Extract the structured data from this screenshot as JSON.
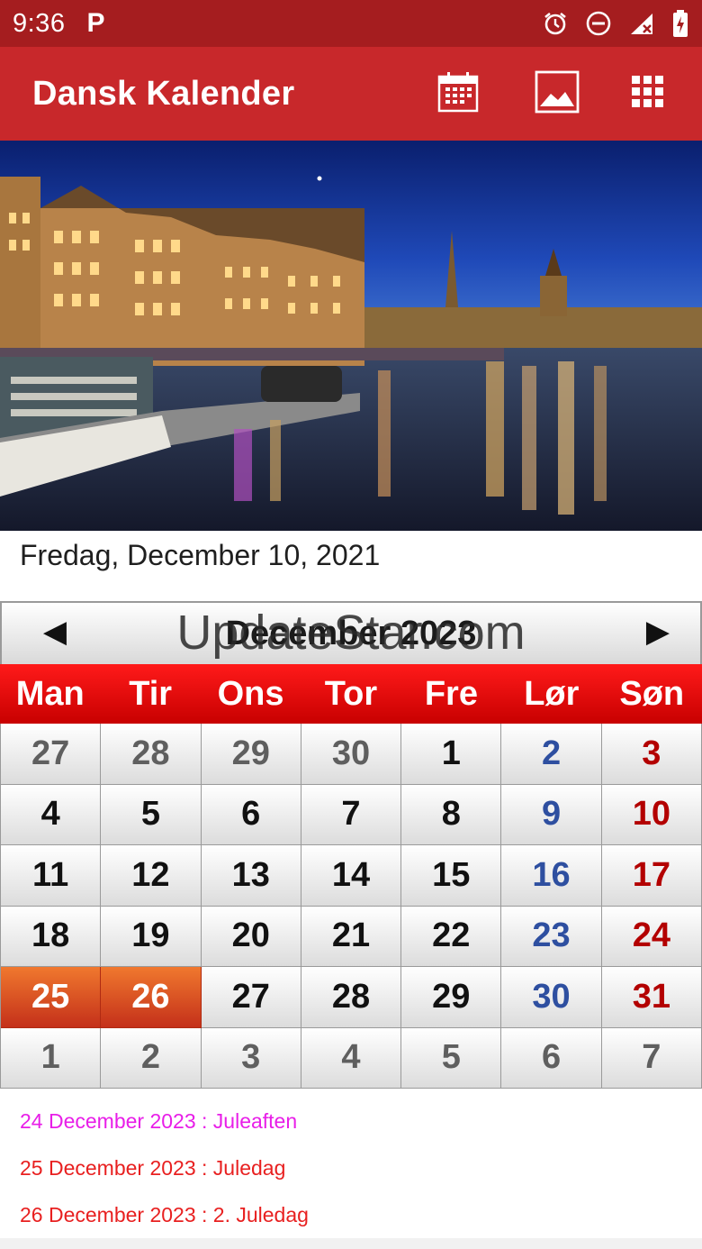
{
  "status_bar": {
    "time": "9:36",
    "notification_icon": "P"
  },
  "app_bar": {
    "title": "Dansk Kalender",
    "actions": [
      "calendar-icon",
      "image-icon",
      "grid-icon"
    ]
  },
  "selected_date": "Fredag, December 10, 2021",
  "calendar": {
    "prev_arrow": "◀",
    "next_arrow": "▶",
    "month_title": "December 2023",
    "watermark": "UpdateStar.com",
    "weekdays": [
      "Man",
      "Tir",
      "Ons",
      "Tor",
      "Fre",
      "Lør",
      "Søn"
    ],
    "weeks": [
      [
        "27",
        "28",
        "29",
        "30",
        "1",
        "2",
        "3"
      ],
      [
        "4",
        "5",
        "6",
        "7",
        "8",
        "9",
        "10"
      ],
      [
        "11",
        "12",
        "13",
        "14",
        "15",
        "16",
        "17"
      ],
      [
        "18",
        "19",
        "20",
        "21",
        "22",
        "23",
        "24"
      ],
      [
        "25",
        "26",
        "27",
        "28",
        "29",
        "30",
        "31"
      ],
      [
        "1",
        "2",
        "3",
        "4",
        "5",
        "6",
        "7"
      ]
    ],
    "colors": {
      "saturday": "#2e4fa0",
      "sunday": "#b30000",
      "other_month": "#5f5f5f",
      "holiday_highlight": "#e0561f",
      "header_red": "#e00000"
    }
  },
  "holidays": [
    {
      "text": "24 December 2023 : Juleaften",
      "color": "#e81ee8"
    },
    {
      "text": "25 December 2023 : Juledag",
      "color": "#e82020"
    },
    {
      "text": "26 December 2023 : 2. Juledag",
      "color": "#e82020"
    }
  ]
}
